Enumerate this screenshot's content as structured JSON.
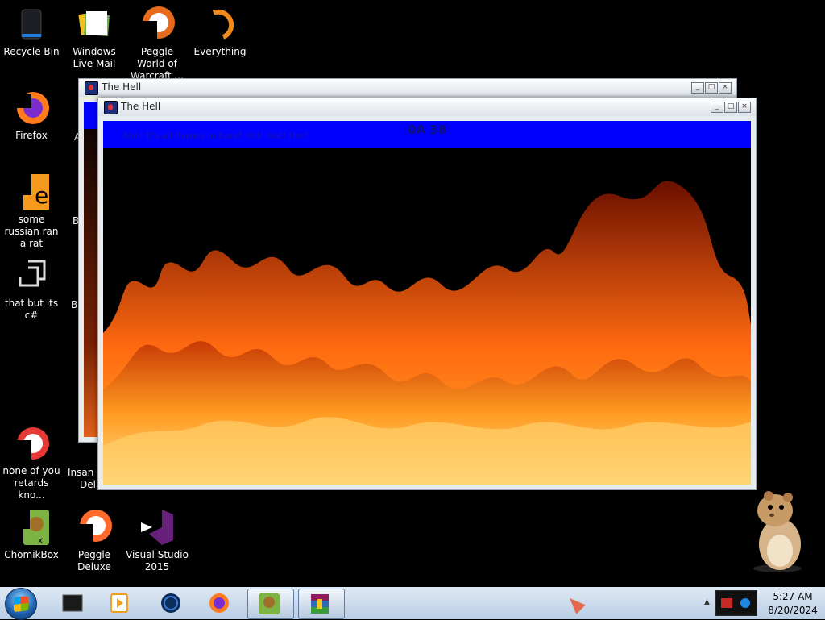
{
  "desktop": {
    "icons": [
      {
        "label": "Recycle Bin"
      },
      {
        "label": "Windows Live Mail"
      },
      {
        "label": "Peggle World of Warcraft ..."
      },
      {
        "label": "Everything"
      },
      {
        "label": "Firefox"
      },
      {
        "label": "some russian ran a rat"
      },
      {
        "label": "that but its c#"
      },
      {
        "label": "none of you retards kno..."
      },
      {
        "label": "ChomikBox"
      },
      {
        "label": "Peggle Deluxe"
      },
      {
        "label": "Visual Studio 2015"
      }
    ],
    "partial_labels": [
      "A",
      "B",
      "B",
      "Insan",
      "Delu"
    ]
  },
  "windows": [
    {
      "title": "The Hell"
    },
    {
      "title": "The Hell",
      "counter": "0A 38",
      "message": "Ahh! It's all flames in here! Hot! Hot! Hot!"
    }
  ],
  "window_controls": {
    "minimize": "_",
    "maximize": "□",
    "close": "×"
  },
  "taskbar": {
    "pinned": [
      "terminal-icon",
      "media-player-icon",
      "globe-icon",
      "firefox-icon",
      "chomikbox-icon",
      "winrar-icon"
    ],
    "show_hidden": "▲",
    "clock": {
      "time": "5:27 AM",
      "date": "8/20/2024"
    }
  },
  "colors": {
    "bluebar": "#0000ff",
    "taskbar": "#c9d9ec",
    "desktop": "#000000"
  }
}
